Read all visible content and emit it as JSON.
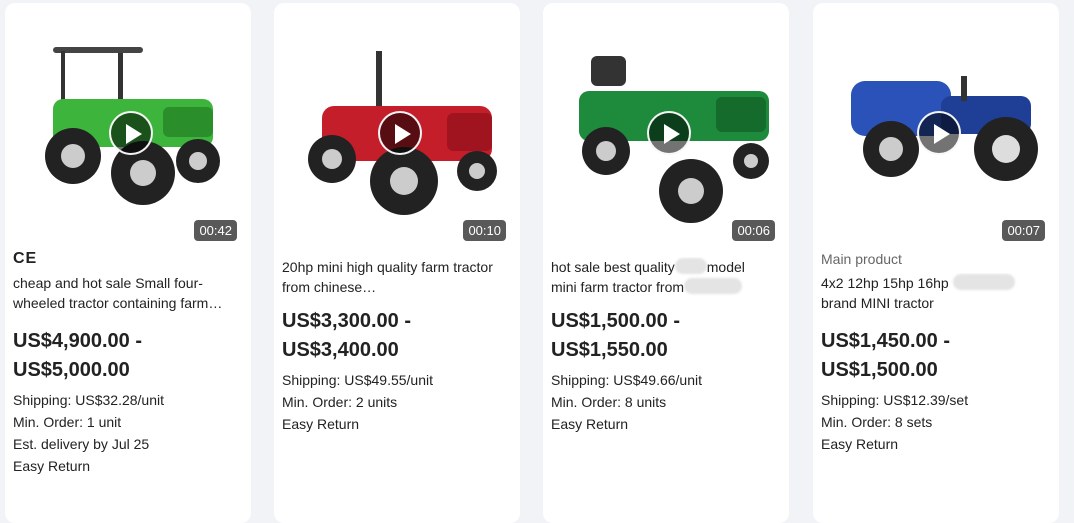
{
  "products": [
    {
      "duration": "00:42",
      "badge": "CE",
      "title": "cheap and hot sale Small four-wheeled tractor containing farm…",
      "price_line1": "US$4,900.00 -",
      "price_line2": "US$5,000.00",
      "shipping": "Shipping: US$32.28/unit",
      "min_order": "Min. Order: 1 unit",
      "delivery": "Est. delivery by Jul 25",
      "return": "Easy Return",
      "body_color": "#3db53d"
    },
    {
      "duration": "00:10",
      "title": "20hp mini high quality farm tractor from chinese…",
      "price_line1": "US$3,300.00 -",
      "price_line2": "US$3,400.00",
      "shipping": "Shipping: US$49.55/unit",
      "min_order": "Min. Order: 2 units",
      "return": "Easy Return",
      "body_color": "#c41e2b"
    },
    {
      "duration": "00:06",
      "title_part1": "hot sale best quality",
      "title_part2": "model",
      "title_part3": "mini farm tractor from",
      "price_line1": "US$1,500.00 -",
      "price_line2": "US$1,550.00",
      "shipping": "Shipping: US$49.66/unit",
      "min_order": "Min. Order: 8 units",
      "return": "Easy Return",
      "body_color": "#1e8a3c"
    },
    {
      "duration": "00:07",
      "tag": "Main product",
      "title_part1": "4x2 12hp 15hp 16hp",
      "title_part2": "brand MINI tractor",
      "price_line1": "US$1,450.00 -",
      "price_line2": "US$1,500.00",
      "shipping": "Shipping: US$12.39/set",
      "min_order": "Min. Order: 8 sets",
      "return": "Easy Return",
      "body_color": "#2a52b8"
    }
  ]
}
